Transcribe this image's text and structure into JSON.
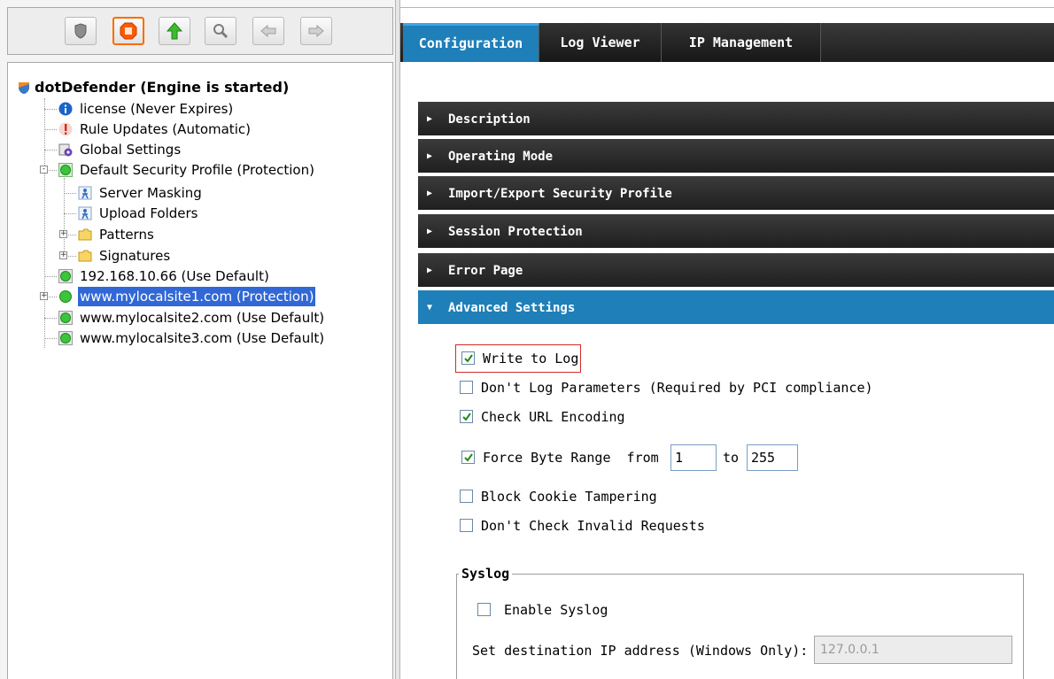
{
  "toolbar": {
    "buttons": [
      {
        "name": "shield-icon"
      },
      {
        "name": "stop-icon",
        "active": true
      },
      {
        "name": "up-arrow-icon"
      },
      {
        "name": "magnifier-icon"
      },
      {
        "name": "back-arrow-icon"
      },
      {
        "name": "forward-arrow-icon"
      }
    ]
  },
  "tree": {
    "root": "dotDefender (Engine is started)",
    "items": [
      {
        "label": "license (Never Expires)",
        "icon": "info-icon"
      },
      {
        "label": "Rule Updates (Automatic)",
        "icon": "warning-icon"
      },
      {
        "label": "Global Settings",
        "icon": "settings-icon"
      },
      {
        "label": "Default Security Profile (Protection)",
        "icon": "green-status-icon",
        "expander": "-"
      },
      {
        "label": "Server Masking",
        "icon": "masking-icon"
      },
      {
        "label": "Upload Folders",
        "icon": "folder-upload-icon"
      },
      {
        "label": "Patterns",
        "icon": "folder-icon",
        "expander": "+"
      },
      {
        "label": "Signatures",
        "icon": "folder-icon",
        "expander": "+"
      },
      {
        "label": "192.168.10.66 (Use Default)",
        "icon": "site-default-icon"
      },
      {
        "label": "www.mylocalsite1.com (Protection)",
        "icon": "green-status-icon",
        "expander": "+",
        "selected": true
      },
      {
        "label": "www.mylocalsite2.com (Use Default)",
        "icon": "site-default-icon"
      },
      {
        "label": "www.mylocalsite3.com (Use Default)",
        "icon": "site-default-icon"
      }
    ]
  },
  "tabs": [
    "Configuration",
    "Log Viewer",
    "IP Management"
  ],
  "active_tab": "Configuration",
  "sections": [
    {
      "title": "Description",
      "arrow": "▶"
    },
    {
      "title": "Operating Mode",
      "arrow": "▶"
    },
    {
      "title": "Import/Export Security Profile",
      "arrow": "▶"
    },
    {
      "title": "Session Protection",
      "arrow": "▶"
    },
    {
      "title": "Error Page",
      "arrow": "▶"
    },
    {
      "title": "Advanced Settings",
      "arrow": "▼",
      "open": true
    }
  ],
  "advanced": {
    "write_to_log": {
      "label": "Write to Log",
      "checked": true
    },
    "dont_log_params": {
      "label": "Don't Log Parameters (Required by PCI compliance)",
      "checked": false
    },
    "check_url": {
      "label": "Check URL Encoding",
      "checked": true
    },
    "force_byte": {
      "label": "Force Byte Range  from",
      "to_label": "to",
      "from": "1",
      "to": "255",
      "checked": true
    },
    "block_cookie": {
      "label": "Block Cookie Tampering",
      "checked": false
    },
    "dont_check_invalid": {
      "label": "Don't Check Invalid Requests",
      "checked": false
    }
  },
  "syslog": {
    "legend": "Syslog",
    "enable_label": "Enable Syslog",
    "enable_checked": false,
    "dest_label": "Set destination IP address (Windows Only):",
    "dest_value": "127.0.0.1"
  },
  "colors": {
    "accent": "#1f7fb8",
    "selection": "#3168d5",
    "highlight_border": "#d22b2b",
    "status_green": "#3cc43c"
  }
}
